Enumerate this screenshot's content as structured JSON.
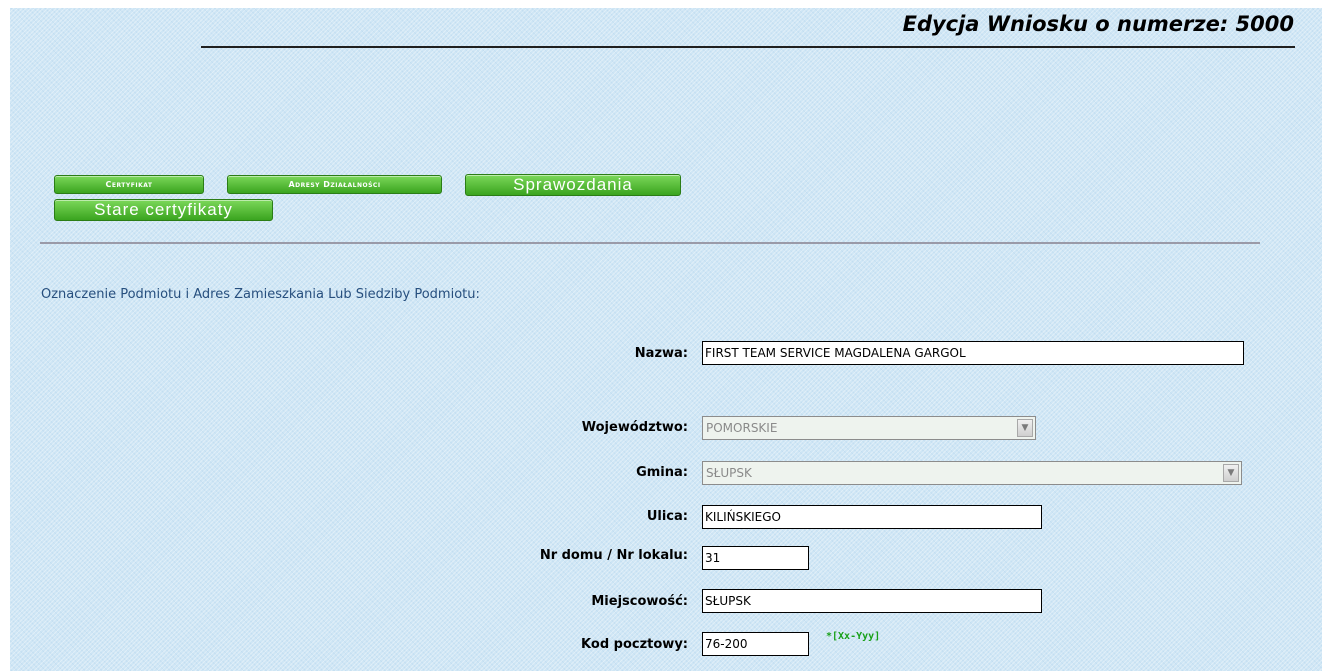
{
  "header": {
    "title": "Edycja Wniosku o numerze: 5000"
  },
  "buttons": {
    "certyfikat": "Certyfikat",
    "adresy": "Adresy Działalności",
    "sprawozdania": "Sprawozdania",
    "stare": "Stare certyfikaty"
  },
  "section": {
    "heading": "Oznaczenie Podmiotu i Adres Zamieszkania Lub Siedziby Podmiotu:"
  },
  "form": {
    "nazwa": {
      "label": "Nazwa:",
      "value": "FIRST TEAM SERVICE MAGDALENA GARGOL"
    },
    "wojewodztwo": {
      "label": "Województwo:",
      "value": "POMORSKIE"
    },
    "gmina": {
      "label": "Gmina:",
      "value": "SŁUPSK"
    },
    "ulica": {
      "label": "Ulica:",
      "value": "KILIŃSKIEGO"
    },
    "nr_domu": {
      "label": "Nr domu / Nr lokalu:",
      "value": "31"
    },
    "miejscowosc": {
      "label": "Miejscowość:",
      "value": "SŁUPSK"
    },
    "kod_pocztowy": {
      "label": "Kod pocztowy:",
      "value": "76-200",
      "hint": "*[Xx-Yyy]"
    }
  },
  "colors": {
    "background": "#cfe6f5",
    "button_green": "#3aa41f",
    "heading_blue": "#274f7e",
    "hint_green": "#18a018"
  }
}
